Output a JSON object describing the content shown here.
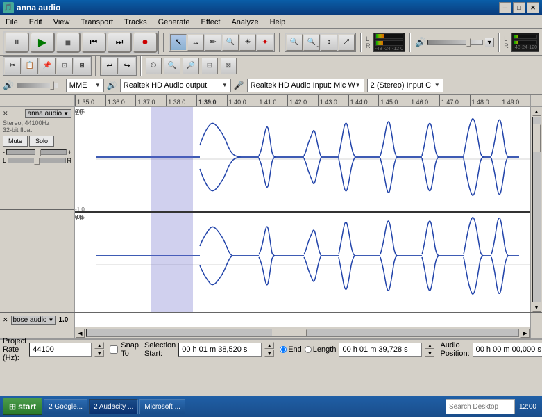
{
  "window": {
    "title": "anna audio",
    "icon": "🎵"
  },
  "titlebar": {
    "minimize": "─",
    "maximize": "□",
    "close": "✕"
  },
  "menu": {
    "items": [
      "File",
      "Edit",
      "View",
      "Transport",
      "Tracks",
      "Generate",
      "Effect",
      "Analyze",
      "Help"
    ]
  },
  "transport": {
    "pause_label": "⏸",
    "play_label": "▶",
    "stop_label": "■",
    "skip_back_label": "⏮",
    "skip_fwd_label": "⏭",
    "record_label": "●"
  },
  "tools": {
    "select": "↖",
    "zoom_in": "🔍+",
    "envelope": "✥",
    "draw": "✏",
    "zoom": "🔍",
    "timeshift": "↔",
    "multi": "✳",
    "volume_icon": "🔊"
  },
  "ruler": {
    "ticks": [
      "1:35.0",
      "1:36.0",
      "1:37.0",
      "1:38.0",
      "1:39.0",
      "1:40.0",
      "1:41.0",
      "1:42.0",
      "1:43.0",
      "1:44.0",
      "1:45.0",
      "1:46.0",
      "1:47.0",
      "1:48.0",
      "1:49.0"
    ]
  },
  "track1": {
    "name": "anna audio",
    "info_line1": "Stereo, 44100Hz",
    "info_line2": "32-bit float",
    "mute": "Mute",
    "solo": "Solo",
    "vol_label": "-",
    "gain_label": "+"
  },
  "track2": {
    "name": "bose audio",
    "close_x": "✕"
  },
  "devices": {
    "api_label": "MME",
    "output_label": "Realtek HD Audio output",
    "mic_icon": "🎤",
    "input_label": "Realtek HD Audio Input: Mic W",
    "channels_label": "2 (Stereo) Input C"
  },
  "meter_labels": [
    "-48",
    "-24",
    "-12",
    "0",
    "-48",
    "-24",
    "-12",
    "0"
  ],
  "status": {
    "project_rate_label": "Project Rate (Hz):",
    "project_rate_value": "44100",
    "snap_label": "Snap To",
    "selection_start_label": "Selection Start:",
    "selection_start_value": "00 h 01 m 38,520 s",
    "end_label": "End",
    "length_label": "Length",
    "selection_end_value": "00 h 01 m 39,728 s",
    "audio_pos_label": "Audio Position:",
    "audio_pos_value": "00 h 00 m 00,000 s"
  },
  "taskbar": {
    "start_label": "start",
    "items": [
      {
        "label": "2 Google...",
        "active": false
      },
      {
        "label": "2 Audacity ...",
        "active": true
      },
      {
        "label": "Microsoft ...",
        "active": false
      }
    ],
    "search_placeholder": "Search Desktop"
  }
}
